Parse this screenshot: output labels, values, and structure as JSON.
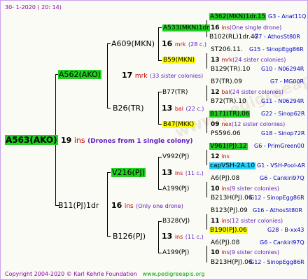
{
  "header": "30-   1-2020  ( 20:  14)",
  "watermark": "www.pedigreeapis.org",
  "footer": {
    "copyright": "Copyright 2004-2020 © Karl Kehrle Foundation",
    "url": "www.pedigreeapis.org"
  },
  "root": {
    "name": "A563(AKO)",
    "count": "19",
    "ins": "ins",
    "note": "(Drones from 1 single colony)"
  },
  "gen1": [
    {
      "name": "A562(AKO)",
      "count": "17",
      "ins": "mrk",
      "note": "(33 sister colonies)"
    },
    {
      "name": "B11(PJ)1dr",
      "count": "16",
      "ins": "ins",
      "note": "(Only one drone)"
    }
  ],
  "gen2": [
    {
      "name": "A609(MKN)",
      "count": "16",
      "ins": "mrk",
      "note": "(28 c.)"
    },
    {
      "name": "B26(TR)",
      "count": "13",
      "ins": "bal",
      "note": "(22 c.)"
    },
    {
      "name": "V216(PJ)",
      "count": "13",
      "ins": "ins",
      "note": "(11 c.)"
    },
    {
      "name": "B126(PJ)",
      "count": "13",
      "ins": "ins",
      "note": "(11 c.)"
    }
  ],
  "gen3": [
    {
      "name": "A533(MKN)1dr",
      "count": "16",
      "ins": "ins",
      "note": "(One single drone)"
    },
    {
      "name": "B59(MKN)",
      "count": "13",
      "ins": "mrk",
      "note": "(24 sister colonies)"
    },
    {
      "name": "B77(TR)",
      "count": "12",
      "ins": "bal",
      "note": "(24 sister colonies)"
    },
    {
      "name": "B47(MKK)",
      "count": "09",
      "ins": "nex",
      "note": "(12 sister colonies)"
    },
    {
      "name": "V992(PJ)",
      "count": "12",
      "ins": "ins",
      "note": ""
    },
    {
      "name": "A199(PJ)",
      "count": "10",
      "ins": "ins",
      "note": "(9 sister colonies)"
    },
    {
      "name": "B328(VJ)",
      "count": "11",
      "ins": "ins",
      "note": "(12 sister colonies)"
    },
    {
      "name": "A199(PJ)",
      "count": "10",
      "ins": "ins",
      "note": "(9 sister colonies)"
    }
  ],
  "gen4": [
    {
      "name": "A362(MKN)1dr.15",
      "ref": "G3 - Anat11Q"
    },
    {
      "name": "B102(RL)1dr.47",
      "ref": "G7 - AthosSt80R"
    },
    {
      "name": "ST206.11.",
      "ref": "G15 - SinopEgg86R"
    },
    {
      "name": "B129(TR).10",
      "ref": "G10 - N06294R"
    },
    {
      "name": "B7(TR).09",
      "ref": "G7 - MG00R"
    },
    {
      "name": "B72(TR).10",
      "ref": "G11 - N06294R"
    },
    {
      "name": "B171(TR).06",
      "ref": "G22 - Sinop62R"
    },
    {
      "name": "PS596.06",
      "ref": "G18 - Sinop72R"
    },
    {
      "name": "V961(PJ).12",
      "ref": "G6 - PrimGreen00"
    },
    {
      "name": "capVSH-2A.10",
      "ref": "G1 - VSH-Pool-AR"
    },
    {
      "name": "A6(PJ).08",
      "ref": "G6 - Cankiri97Q"
    },
    {
      "name": "B213H(PJ).06",
      "ref": "G12 - SinopEgg86R"
    },
    {
      "name": "B123(PJ).09",
      "ref": "G16 - AthosSt80R"
    },
    {
      "name": "B190(PJ).06",
      "ref": "G28 - B-xx43"
    },
    {
      "name": "A6(PJ).08",
      "ref": "G6 - Cankiri97Q"
    },
    {
      "name": "B213H(PJ).06",
      "ref": "G12 - SinopEgg86R"
    }
  ],
  "colors": {
    "highlight_green": "#20cf20",
    "highlight_yellow": "#ffff00",
    "highlight_cyan": "#22d3ff",
    "ins_red": "#c00000",
    "note_purple": "#6020c0",
    "ref_blue": "#0000c0"
  }
}
